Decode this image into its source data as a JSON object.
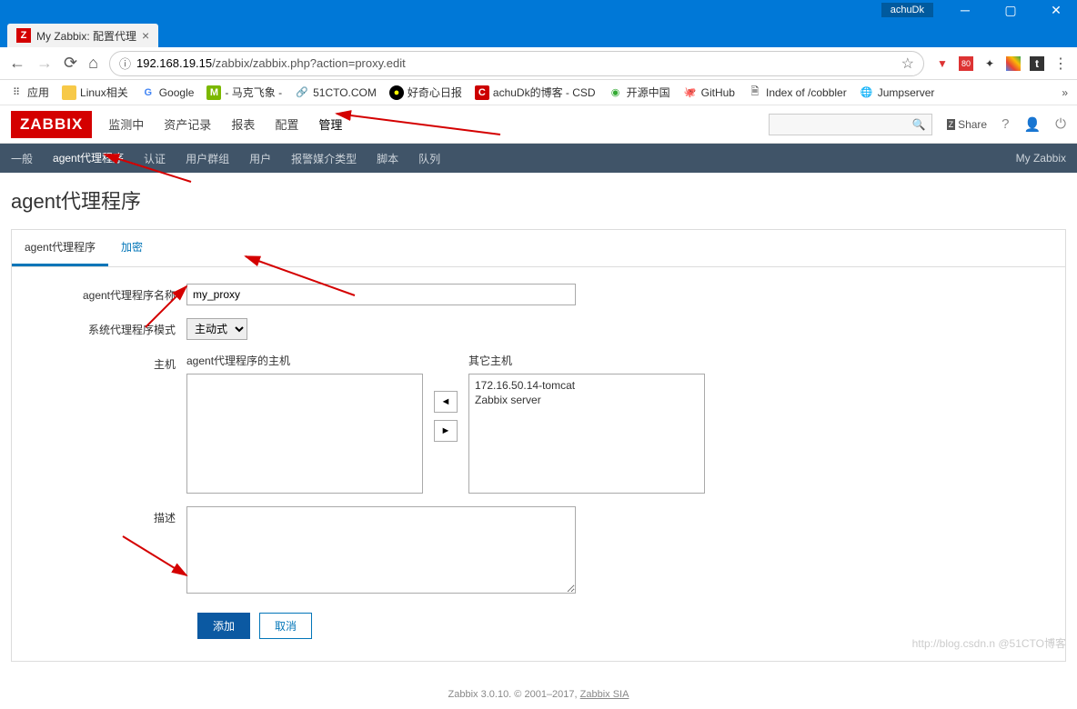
{
  "browser": {
    "user": "achuDk",
    "tab_title": "My Zabbix: 配置代理",
    "url_host": "192.168.19.15",
    "url_path": "/zabbix/zabbix.php?action=proxy.edit",
    "bookmarks": {
      "apps": "应用",
      "linux": "Linux相关",
      "google": "Google",
      "mark": "- 马克飞象 -",
      "cto": "51CTO.COM",
      "daily": "好奇心日报",
      "csdn": "achuDk的博客 - CSD",
      "oschina": "开源中国",
      "github": "GitHub",
      "cobbler": "Index of /cobbler",
      "jumpserver": "Jumpserver"
    }
  },
  "zabbix": {
    "logo": "ZABBIX",
    "menu": {
      "monitoring": "监测中",
      "inventory": "资产记录",
      "reports": "报表",
      "config": "配置",
      "admin": "管理"
    },
    "share": "Share",
    "subnav": {
      "general": "一般",
      "proxies": "agent代理程序",
      "auth": "认证",
      "usergroups": "用户群组",
      "users": "用户",
      "mediatypes": "报警媒介类型",
      "scripts": "脚本",
      "queue": "队列",
      "right": "My Zabbix"
    },
    "page_title": "agent代理程序",
    "form_tabs": {
      "proxy": "agent代理程序",
      "encryption": "加密"
    },
    "form": {
      "name_label": "agent代理程序名称",
      "name_value": "my_proxy",
      "mode_label": "系统代理程序模式",
      "mode_value": "主动式",
      "hosts_label": "主机",
      "proxy_hosts_header": "agent代理程序的主机",
      "other_hosts_header": "其它主机",
      "other_hosts": [
        "172.16.50.14-tomcat",
        "Zabbix server"
      ],
      "desc_label": "描述",
      "desc_value": "",
      "add": "添加",
      "cancel": "取消"
    },
    "footer": "Zabbix 3.0.10. © 2001–2017, ",
    "footer_link": "Zabbix SIA",
    "watermark": "http://blog.csdn.n @51CTO博客"
  }
}
